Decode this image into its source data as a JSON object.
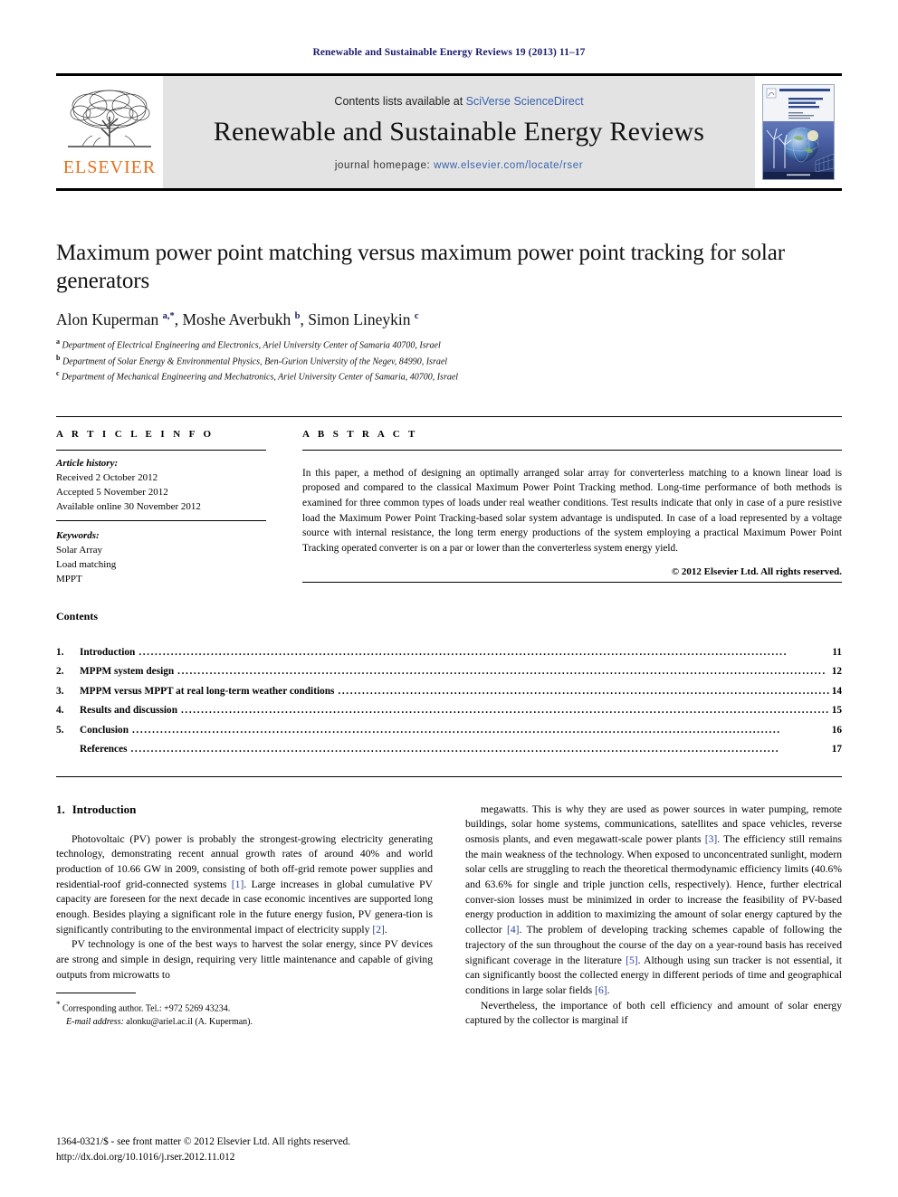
{
  "running_head": "Renewable and Sustainable Energy Reviews 19 (2013) 11–17",
  "masthead": {
    "publisher_name": "ELSEVIER",
    "contents_prefix": "Contents lists available at ",
    "contents_link": "SciVerse ScienceDirect",
    "journal_title": "Renewable and Sustainable Energy Reviews",
    "homepage_prefix": "journal homepage: ",
    "homepage_url": "www.elsevier.com/locate/rser",
    "cover_title_line1": "Renewable &",
    "cover_title_line2": "Sustainable",
    "cover_title_line3": "Energy Reviews"
  },
  "article": {
    "title": "Maximum power point matching versus maximum power point tracking for solar generators",
    "authors_html": "Alon Kuperman <sup>a,*</sup>, Moshe Averbukh <sup>b</sup>, Simon Lineykin <sup>c</sup>",
    "affiliations": [
      {
        "mark": "a",
        "text": "Department of Electrical Engineering and Electronics, Ariel University Center of Samaria 40700, Israel"
      },
      {
        "mark": "b",
        "text": "Department of Solar Energy & Environmental Physics, Ben-Gurion University of the Negev, 84990, Israel"
      },
      {
        "mark": "c",
        "text": "Department of Mechanical Engineering and Mechatronics, Ariel University Center of Samaria, 40700, Israel"
      }
    ]
  },
  "info": {
    "section_label": "A R T I C L E  I N F O",
    "history_label": "Article history:",
    "history": [
      "Received 2 October 2012",
      "Accepted 5 November 2012",
      "Available online 30 November 2012"
    ],
    "keywords_label": "Keywords:",
    "keywords": [
      "Solar Array",
      "Load matching",
      "MPPT"
    ]
  },
  "abstract": {
    "section_label": "A B S T R A C T",
    "text": "In this paper, a method of designing an optimally arranged solar array for converterless matching to a known linear load is proposed and compared to the classical Maximum Power Point Tracking method. Long-time performance of both methods is examined for three common types of loads under real weather conditions. Test results indicate that only in case of a pure resistive load the Maximum Power Point Tracking-based solar system advantage is undisputed. In case of a load represented by a voltage source with internal resistance, the long term energy productions of the system employing a practical Maximum Power Point Tracking operated converter is on a par or lower than the converterless system energy yield.",
    "copyright": "© 2012 Elsevier Ltd. All rights reserved."
  },
  "contents": {
    "heading": "Contents",
    "entries": [
      {
        "num": "1.",
        "label": "Introduction",
        "page": "11"
      },
      {
        "num": "2.",
        "label": "MPPM system design",
        "page": "12"
      },
      {
        "num": "3.",
        "label": "MPPM versus MPPT at real long-term weather conditions",
        "page": "14"
      },
      {
        "num": "4.",
        "label": "Results and discussion",
        "page": "15"
      },
      {
        "num": "5.",
        "label": "Conclusion",
        "page": "16"
      },
      {
        "num": "",
        "label": "References",
        "page": "17"
      }
    ]
  },
  "body": {
    "section_number": "1.",
    "section_title": "Introduction",
    "left_paragraph_1_html": "Photovoltaic (PV) power is probably the strongest-growing electricity generating technology, demonstrating recent annual growth rates of around 40% and world production of 10.66 GW in 2009, consisting of both off-grid remote power supplies and residential-roof grid-connected systems <span class=\"ref\">[1]</span>. Large increases in global cumulative PV capacity are foreseen for the next decade in case economic incentives are supported long enough. Besides playing a significant role in the future energy fusion, PV genera-tion is significantly contributing to the environmental impact of electricity supply <span class=\"ref\">[2]</span>.",
    "left_paragraph_2_html": "PV technology is one of the best ways to harvest the solar energy, since PV devices are strong and simple in design, requiring very little maintenance and capable of giving outputs from microwatts to",
    "right_paragraph_1_html": "megawatts. This is why they are used as power sources in water pumping, remote buildings, solar home systems, communications, satellites and space vehicles, reverse osmosis plants, and even megawatt-scale power plants <span class=\"ref\">[3]</span>. The efficiency still remains the main weakness of the technology. When exposed to unconcentrated sunlight, modern solar cells are struggling to reach the theoretical thermodynamic efficiency limits (40.6% and 63.6% for single and triple junction cells, respectively). Hence, further electrical conver-sion losses must be minimized in order to increase the feasibility of PV-based energy production in addition to maximizing the amount of solar energy captured by the collector <span class=\"ref\">[4]</span>. The problem of developing tracking schemes capable of following the trajectory of the sun throughout the course of the day on a year-round basis has received significant coverage in the literature <span class=\"ref\">[5]</span>. Although using sun tracker is not essential, it can significantly boost the collected energy in different periods of time and geographical conditions in large solar fields <span class=\"ref\">[6]</span>.",
    "right_paragraph_2_html": "Nevertheless, the importance of both cell efficiency and amount of solar energy captured by the collector is marginal if"
  },
  "footnote": {
    "corresponding_html": "<span class=\"star\">*</span> Corresponding author. Tel.: +972 5269 43234.",
    "email_html": "<span class=\"em\">E-mail address:</span> alonku@ariel.ac.il (A. Kuperman)."
  },
  "footer": {
    "issn_line": "1364-0321/$ - see front matter © 2012 Elsevier Ltd. All rights reserved.",
    "doi_line": "http://dx.doi.org/10.1016/j.rser.2012.11.012"
  },
  "colors": {
    "running_head": "#1a1a6e",
    "link_blue": "#3a63ad",
    "elsevier_orange": "#E9711C",
    "reference_blue": "#2b3f9e",
    "masthead_band": "#e3e3e3"
  }
}
